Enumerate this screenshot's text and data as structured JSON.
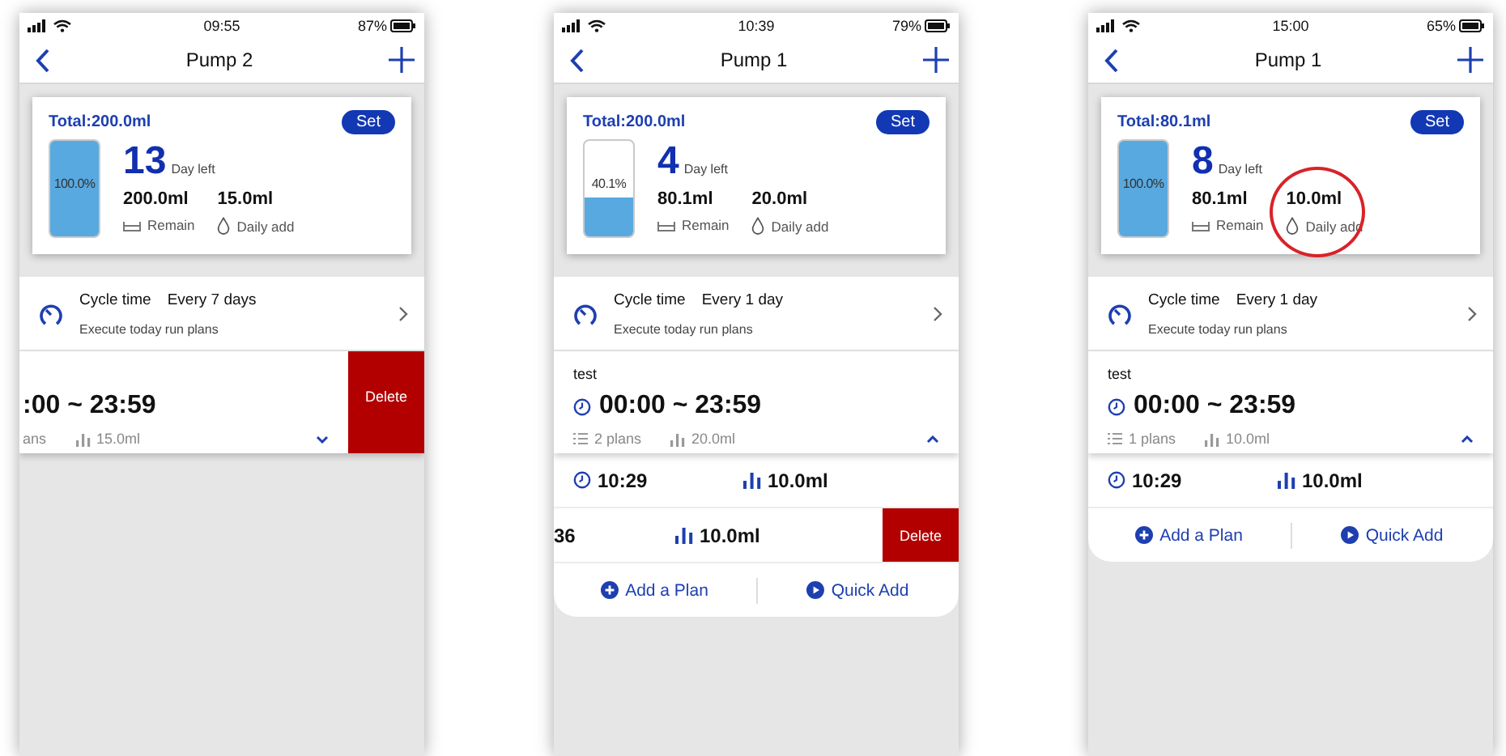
{
  "phones": [
    {
      "status": {
        "time": "09:55",
        "battery": "87%"
      },
      "title": "Pump 2",
      "card": {
        "total": "Total:200.0ml",
        "set": "Set",
        "tank_label": "100.0%",
        "level": 1.0,
        "days": "13",
        "days_label": "Day left",
        "remain": "200.0ml",
        "remain_label": "Remain",
        "daily": "15.0ml",
        "daily_label": "Daily add",
        "daily_circled": false
      },
      "cycle": {
        "label": "Cycle time",
        "value": "Every 7 days",
        "note": "Execute today run plans"
      },
      "plan": {
        "time": ":00 ~ 23:59",
        "plans": "ans",
        "amount": "15.0ml",
        "expanded": false,
        "swiped": true,
        "delete": "Delete"
      }
    },
    {
      "status": {
        "time": "10:39",
        "battery": "79%"
      },
      "title": "Pump 1",
      "card": {
        "total": "Total:200.0ml",
        "set": "Set",
        "tank_label": "40.1%",
        "level": 0.401,
        "days": "4",
        "days_label": "Day left",
        "remain": "80.1ml",
        "remain_label": "Remain",
        "daily": "20.0ml",
        "daily_label": "Daily add",
        "daily_circled": false
      },
      "cycle": {
        "label": "Cycle time",
        "value": "Every 1 day",
        "note": "Execute today run plans"
      },
      "plan": {
        "name": "test",
        "time": "00:00 ~ 23:59",
        "plans": "2 plans",
        "amount": "20.0ml",
        "expanded": true,
        "swiped": false
      },
      "subplans": [
        {
          "time": "10:29",
          "amount": "10.0ml",
          "swiped": false
        },
        {
          "time": "36",
          "amount": "10.0ml",
          "swiped": true,
          "delete": "Delete"
        }
      ],
      "actions": {
        "add": "Add a Plan",
        "quick": "Quick Add"
      }
    },
    {
      "status": {
        "time": "15:00",
        "battery": "65%"
      },
      "title": "Pump 1",
      "card": {
        "total": "Total:80.1ml",
        "set": "Set",
        "tank_label": "100.0%",
        "level": 1.0,
        "days": "8",
        "days_label": "Day left",
        "remain": "80.1ml",
        "remain_label": "Remain",
        "daily": "10.0ml",
        "daily_label": "Daily add",
        "daily_circled": true
      },
      "cycle": {
        "label": "Cycle time",
        "value": "Every 1 day",
        "note": "Execute today run plans"
      },
      "plan": {
        "name": "test",
        "time": "00:00 ~ 23:59",
        "plans": "1 plans",
        "amount": "10.0ml",
        "expanded": true,
        "swiped": false
      },
      "subplans": [
        {
          "time": "10:29",
          "amount": "10.0ml",
          "swiped": false
        }
      ],
      "actions": {
        "add": "Add a Plan",
        "quick": "Quick Add"
      }
    }
  ]
}
